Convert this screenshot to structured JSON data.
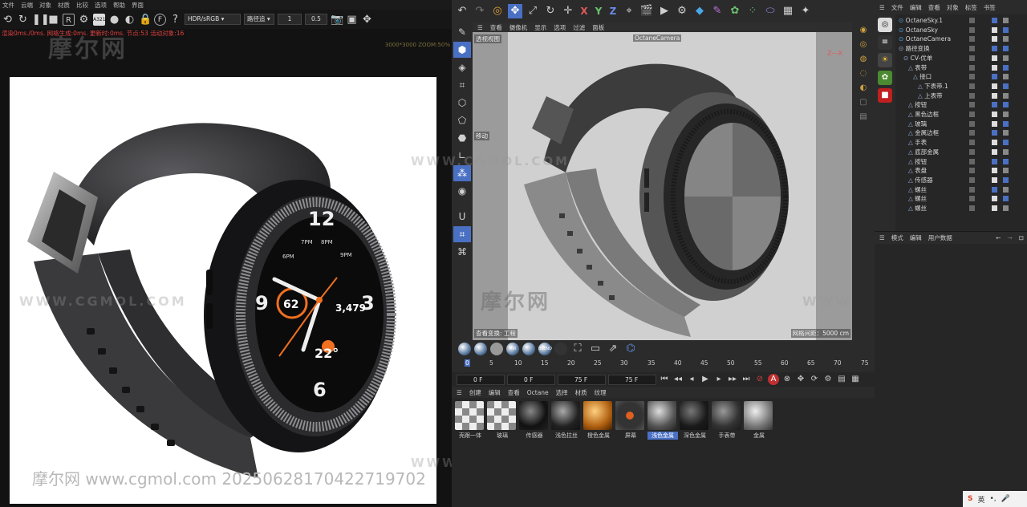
{
  "octane": {
    "menu": [
      "文件",
      "云端",
      "对象",
      "材质",
      "比较",
      "选项",
      "帮助",
      "界面"
    ],
    "color_space": "HDR/sRGB",
    "path_label": "路径追",
    "value1": "1",
    "value2": "0.5",
    "stats": "渲染0ms./0ms. 网格生成:0ms. 更新时:0ms. 节点:53 活动对象:16",
    "resolution": "3000*3000 ZOOM:50%",
    "watch": {
      "n12": "12",
      "n9": "9",
      "n3": "3",
      "n6": "6",
      "hours": [
        "6PM",
        "7PM",
        "8PM",
        "9PM"
      ],
      "left_value": "62",
      "right_value": "3,479",
      "temp": "22°"
    }
  },
  "watermarks": {
    "brand": "摩尔网",
    "url": "WWW.CGMOL.COM",
    "credit": "摩尔网 www.cgmol.com 20250628170422719702"
  },
  "c4d": {
    "axes": [
      "X",
      "Y",
      "Z"
    ],
    "viewport_menu": [
      "查看",
      "摄像机",
      "显示",
      "选项",
      "过滤",
      "面板"
    ],
    "viewport_label": "透视视图",
    "camera_label": "OctaneCamera",
    "move_label": "移动",
    "bottom_left": "查看变换: 工程",
    "grid_label": "网格间距：5000 cm",
    "timeline": {
      "ticks": [
        "0",
        "5",
        "10",
        "15",
        "20",
        "25",
        "30",
        "35",
        "40",
        "45",
        "50",
        "55",
        "60",
        "65",
        "70",
        "75"
      ],
      "fields": [
        "0 F",
        "0 F",
        "75 F",
        "75 F"
      ]
    },
    "material_menu": [
      "创建",
      "编辑",
      "查看",
      "Octane",
      "选择",
      "材质",
      "纹理"
    ],
    "materials": [
      "壳跟一体",
      "玻璃",
      "传感器",
      "浅色拉丝",
      "橙色金属",
      "屏幕",
      "浅色金属",
      "深色金属",
      "手表带",
      "金属"
    ],
    "selected_material": "浅色金属",
    "object_menu": [
      "文件",
      "编辑",
      "查看",
      "对象",
      "标签",
      "书签"
    ],
    "objects": [
      {
        "name": "OctaneSky.1",
        "indent": 0
      },
      {
        "name": "OctaneSky",
        "indent": 0
      },
      {
        "name": "OctaneCamera",
        "indent": 0
      },
      {
        "name": "路径变换",
        "indent": 0
      },
      {
        "name": "CV-优单",
        "indent": 1
      },
      {
        "name": "表带",
        "indent": 2
      },
      {
        "name": "接口",
        "indent": 3
      },
      {
        "name": "下表带.1",
        "indent": 4
      },
      {
        "name": "上表带",
        "indent": 4
      },
      {
        "name": "按钮",
        "indent": 2
      },
      {
        "name": "黑色边框",
        "indent": 2
      },
      {
        "name": "玻璃",
        "indent": 2
      },
      {
        "name": "金属边框",
        "indent": 2
      },
      {
        "name": "手表",
        "indent": 2
      },
      {
        "name": "底部金属",
        "indent": 2
      },
      {
        "name": "按钮",
        "indent": 2
      },
      {
        "name": "表盘",
        "indent": 2
      },
      {
        "name": "传感器",
        "indent": 2
      },
      {
        "name": "螺丝",
        "indent": 2
      },
      {
        "name": "螺丝",
        "indent": 2
      },
      {
        "name": "螺丝",
        "indent": 2
      }
    ],
    "attribute_menu": [
      "模式",
      "编辑",
      "用户数据"
    ]
  },
  "ime": {
    "label": "英"
  }
}
